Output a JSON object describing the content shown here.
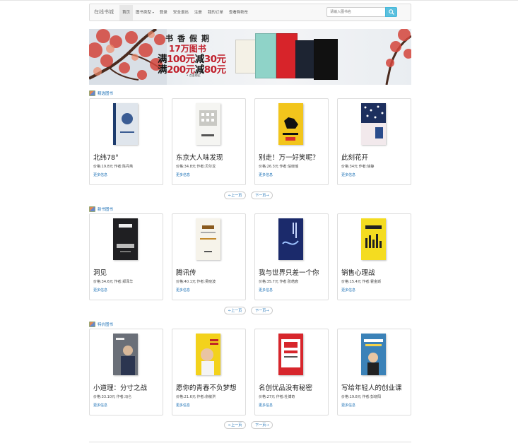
{
  "navbar": {
    "brand": "在线书城",
    "items": [
      {
        "label": "首页",
        "active": true
      },
      {
        "label": "图书类型",
        "dropdown": true
      },
      {
        "label": "登录"
      },
      {
        "label": "安全退出"
      },
      {
        "label": "注册"
      },
      {
        "label": "我的订单"
      },
      {
        "label": "查看购物车"
      }
    ],
    "search_placeholder": "请输入图书名"
  },
  "banner": {
    "title": "书香假期",
    "subtitle": "17万图书",
    "line1_a": "满",
    "line1_b": "100元",
    "line1_c": "减",
    "line1_d": "30元",
    "line2_a": "满",
    "line2_b": "200元",
    "line2_c": "减",
    "line2_d": "80元",
    "note": "• 点击购买"
  },
  "sections": [
    {
      "title": "精选图书",
      "books": [
        {
          "title": "北纬78°",
          "meta": "价格:19.8元 作者:陈丹燕",
          "more": "更多信息"
        },
        {
          "title": "东京大人味发现",
          "meta": "价格:34.8元 作者:贝尔龙",
          "more": "更多信息"
        },
        {
          "title": "别走！万一好笑呢？",
          "meta": "价格:26.3元 作者:信晓瑶",
          "more": "更多信息"
        },
        {
          "title": "此刻花开",
          "meta": "价格:34元 作者:徐静",
          "more": "更多信息"
        }
      ],
      "pager": {
        "prev": "←上一页",
        "next": "下一页→"
      }
    },
    {
      "title": "新书图书",
      "books": [
        {
          "title": "洞见",
          "meta": "价格:34.6元 作者:郑泽华",
          "more": "更多信息"
        },
        {
          "title": "腾讯传",
          "meta": "价格:40.1元 作者:吴晓波",
          "more": "更多信息"
        },
        {
          "title": "我与世界只差一个你",
          "meta": "价格:35.7元 作者:张皓宸",
          "more": "更多信息"
        },
        {
          "title": "销售心理战",
          "meta": "价格:15.4元 作者:霍金斯",
          "more": "更多信息"
        }
      ],
      "pager": {
        "prev": "←上一页",
        "next": "下一页→"
      }
    },
    {
      "title": "特价图书",
      "books": [
        {
          "title": "小道理：分寸之战",
          "meta": "价格:33.10元 作者:冯仑",
          "more": "更多信息"
        },
        {
          "title": "愿你的青春不负梦想",
          "meta": "价格:21.6元 作者:俞敏洪",
          "more": "更多信息"
        },
        {
          "title": "名创优品没有秘密",
          "meta": "价格:27元 作者:杜博奇",
          "more": "更多信息"
        },
        {
          "title": "写给年轻人的创业课",
          "meta": "价格:19.8元 作者:彭晓阳",
          "more": "更多信息"
        }
      ],
      "pager": {
        "prev": "←上一页",
        "next": "下一页→"
      }
    }
  ],
  "colors": {
    "link": "#1a6fb5",
    "search_button": "#5bc0de",
    "banner_red": "#c0202c"
  }
}
